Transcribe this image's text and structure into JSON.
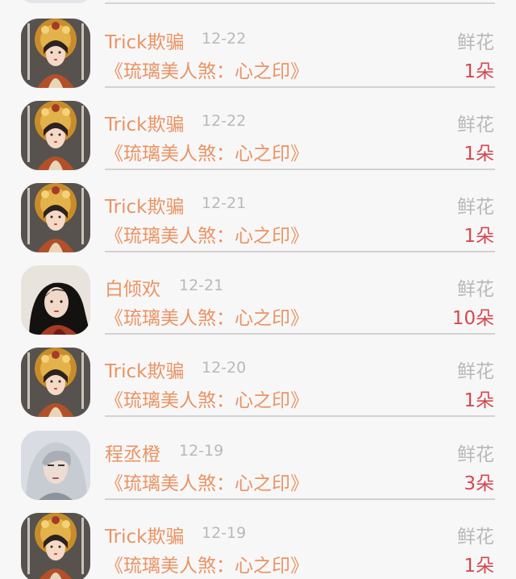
{
  "rows": [
    {
      "user": "Trick欺骗",
      "date": "12-22",
      "gift_type": "鲜花",
      "book": "《琉璃美人煞：心之印》",
      "count": "1朵",
      "avatar": "ornate-headdress-avatar"
    },
    {
      "user": "Trick欺骗",
      "date": "12-22",
      "gift_type": "鲜花",
      "book": "《琉璃美人煞：心之印》",
      "count": "1朵",
      "avatar": "ornate-headdress-avatar"
    },
    {
      "user": "Trick欺骗",
      "date": "12-21",
      "gift_type": "鲜花",
      "book": "《琉璃美人煞：心之印》",
      "count": "1朵",
      "avatar": "ornate-headdress-avatar"
    },
    {
      "user": "白倾欢",
      "date": "12-21",
      "gift_type": "鲜花",
      "book": "《琉璃美人煞：心之印》",
      "count": "10朵",
      "avatar": "dark-hair-portrait-avatar"
    },
    {
      "user": "Trick欺骗",
      "date": "12-20",
      "gift_type": "鲜花",
      "book": "《琉璃美人煞：心之印》",
      "count": "1朵",
      "avatar": "ornate-headdress-avatar"
    },
    {
      "user": "程丞橙",
      "date": "12-19",
      "gift_type": "鲜花",
      "book": "《琉璃美人煞：心之印》",
      "count": "3朵",
      "avatar": "silver-hair-portrait-avatar"
    },
    {
      "user": "Trick欺骗",
      "date": "12-19",
      "gift_type": "鲜花",
      "book": "《琉璃美人煞：心之印》",
      "count": "1朵",
      "avatar": "ornate-headdress-avatar"
    }
  ],
  "colors": {
    "name": "#e99463",
    "date": "#b9b9b9",
    "gift_type": "#b8b8b8",
    "count": "#d5484f",
    "divider": "#d2d2d2",
    "background": "#f8f7f8"
  }
}
